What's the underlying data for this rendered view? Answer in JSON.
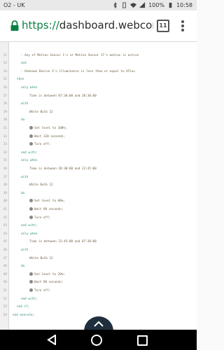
{
  "status_bar": {
    "carrier": "O2 - UK",
    "battery": "100%",
    "time": "10:58",
    "icons": [
      "bluetooth-icon",
      "vibrate-icon",
      "wifi-icon",
      "signal-icon",
      "battery-icon"
    ]
  },
  "browser": {
    "url_scheme": "https://",
    "url_host": "dashboard.webcore.co",
    "tab_count": "11"
  },
  "code_lines": [
    {
      "n": "",
      "indent": 1,
      "text": "",
      "cls": "cm"
    },
    {
      "n": "22",
      "indent": 2,
      "text": "- Any of Motion Sensor 1's or Motion Sensor 17's motion is active",
      "cls": "tx"
    },
    {
      "n": "23",
      "indent": 2,
      "text": "and",
      "cls": "kw"
    },
    {
      "n": "24",
      "indent": 2,
      "text": "- Unknown Device 3's illuminance is less than or equal to 45lux",
      "cls": "tx"
    },
    {
      "n": "25",
      "indent": 1,
      "text": "then",
      "cls": "kw"
    },
    {
      "n": "26",
      "indent": 2,
      "text": "only when",
      "cls": "kw"
    },
    {
      "n": "27",
      "indent": 4,
      "text": "Time is between 07:30:00 and 20:30:00",
      "cls": "tx"
    },
    {
      "n": "28",
      "indent": 2,
      "text": "with",
      "cls": "kw"
    },
    {
      "n": "29",
      "indent": 4,
      "text": "White Bulb 12",
      "cls": "tx"
    },
    {
      "n": "30",
      "indent": 2,
      "text": "do",
      "cls": "kw"
    },
    {
      "n": "31",
      "indent": 4,
      "text": "Set level to 100%;",
      "cls": "tx",
      "icon": "level-icon"
    },
    {
      "n": "32",
      "indent": 4,
      "text": "Wait 120 seconds;",
      "cls": "tx",
      "icon": "clock-icon"
    },
    {
      "n": "33",
      "indent": 4,
      "text": "Turn off;",
      "cls": "tx",
      "icon": "power-icon"
    },
    {
      "n": "34",
      "indent": 2,
      "text": "end with;",
      "cls": "kw"
    },
    {
      "n": "35",
      "indent": 2,
      "text": "only when",
      "cls": "kw"
    },
    {
      "n": "36",
      "indent": 4,
      "text": "Time is between 20:30:00 and 22:45:00",
      "cls": "tx"
    },
    {
      "n": "37",
      "indent": 2,
      "text": "with",
      "cls": "kw"
    },
    {
      "n": "38",
      "indent": 4,
      "text": "White Bulb 12",
      "cls": "tx"
    },
    {
      "n": "39",
      "indent": 2,
      "text": "do",
      "cls": "kw"
    },
    {
      "n": "40",
      "indent": 4,
      "text": "Set level to 60%;",
      "cls": "tx",
      "icon": "level-icon"
    },
    {
      "n": "41",
      "indent": 4,
      "text": "Wait 90 seconds;",
      "cls": "tx",
      "icon": "clock-icon"
    },
    {
      "n": "42",
      "indent": 4,
      "text": "Turn off;",
      "cls": "tx",
      "icon": "power-icon"
    },
    {
      "n": "43",
      "indent": 2,
      "text": "end with;",
      "cls": "kw"
    },
    {
      "n": "44",
      "indent": 2,
      "text": "only when",
      "cls": "kw"
    },
    {
      "n": "45",
      "indent": 4,
      "text": "Time is between 22:45:00 and 07:30:00",
      "cls": "tx"
    },
    {
      "n": "46",
      "indent": 2,
      "text": "with",
      "cls": "kw"
    },
    {
      "n": "47",
      "indent": 4,
      "text": "White Bulb 12",
      "cls": "tx"
    },
    {
      "n": "48",
      "indent": 2,
      "text": "do",
      "cls": "kw"
    },
    {
      "n": "49",
      "indent": 4,
      "text": "Set level to 20%;",
      "cls": "tx",
      "icon": "level-icon"
    },
    {
      "n": "50",
      "indent": 4,
      "text": "Wait 90 seconds;",
      "cls": "tx",
      "icon": "clock-icon"
    },
    {
      "n": "51",
      "indent": 4,
      "text": "Turn off;",
      "cls": "tx",
      "icon": "power-icon"
    },
    {
      "n": "52",
      "indent": 2,
      "text": "end with;",
      "cls": "kw"
    },
    {
      "n": "53",
      "indent": 1,
      "text": "end if;",
      "cls": "kw"
    },
    {
      "n": "54",
      "indent": 0,
      "text": "end execute;",
      "cls": "kw"
    }
  ],
  "fab_icon": "chevron-up-icon",
  "nav": [
    "back-icon",
    "home-icon",
    "recents-icon"
  ]
}
